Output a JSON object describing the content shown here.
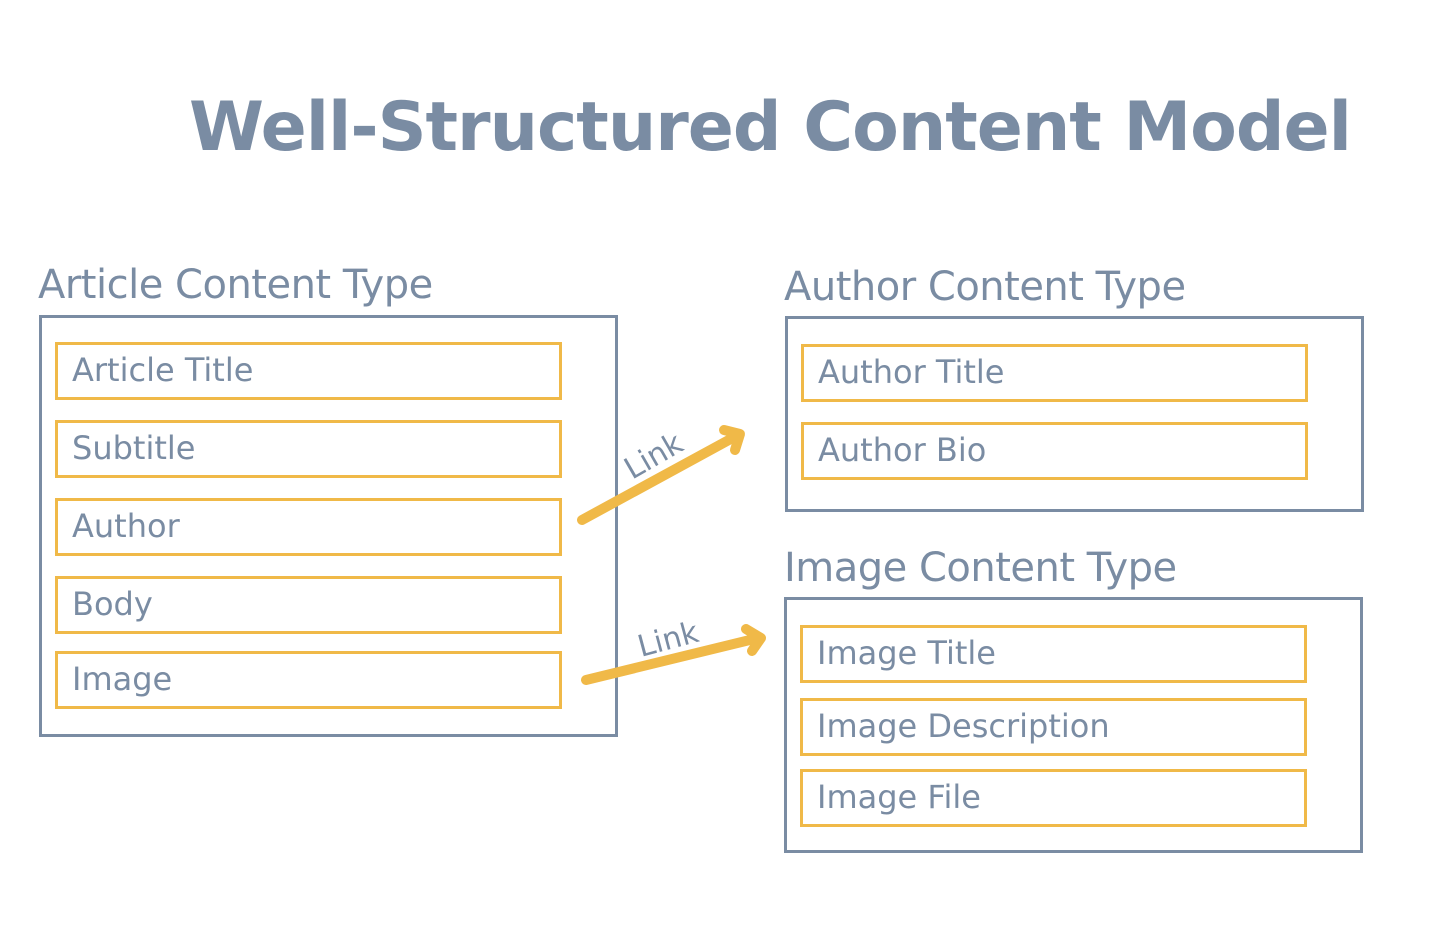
{
  "title": "Well-Structured Content Model",
  "colors": {
    "slate": "#7a8ca3",
    "field_border": "#f0b948",
    "arrow": "#f0b948"
  },
  "article": {
    "heading": "Article Content Type",
    "fields": [
      "Article Title",
      "Subtitle",
      "Author",
      "Body",
      "Image"
    ]
  },
  "author": {
    "heading": "Author Content Type",
    "fields": [
      "Author Title",
      "Author Bio"
    ]
  },
  "image": {
    "heading": "Image Content Type",
    "fields": [
      "Image Title",
      "Image Description",
      "Image File"
    ]
  },
  "links": [
    {
      "label": "Link",
      "from": "Author",
      "to": "Author Content Type"
    },
    {
      "label": "Link",
      "from": "Image",
      "to": "Image Content Type"
    }
  ]
}
